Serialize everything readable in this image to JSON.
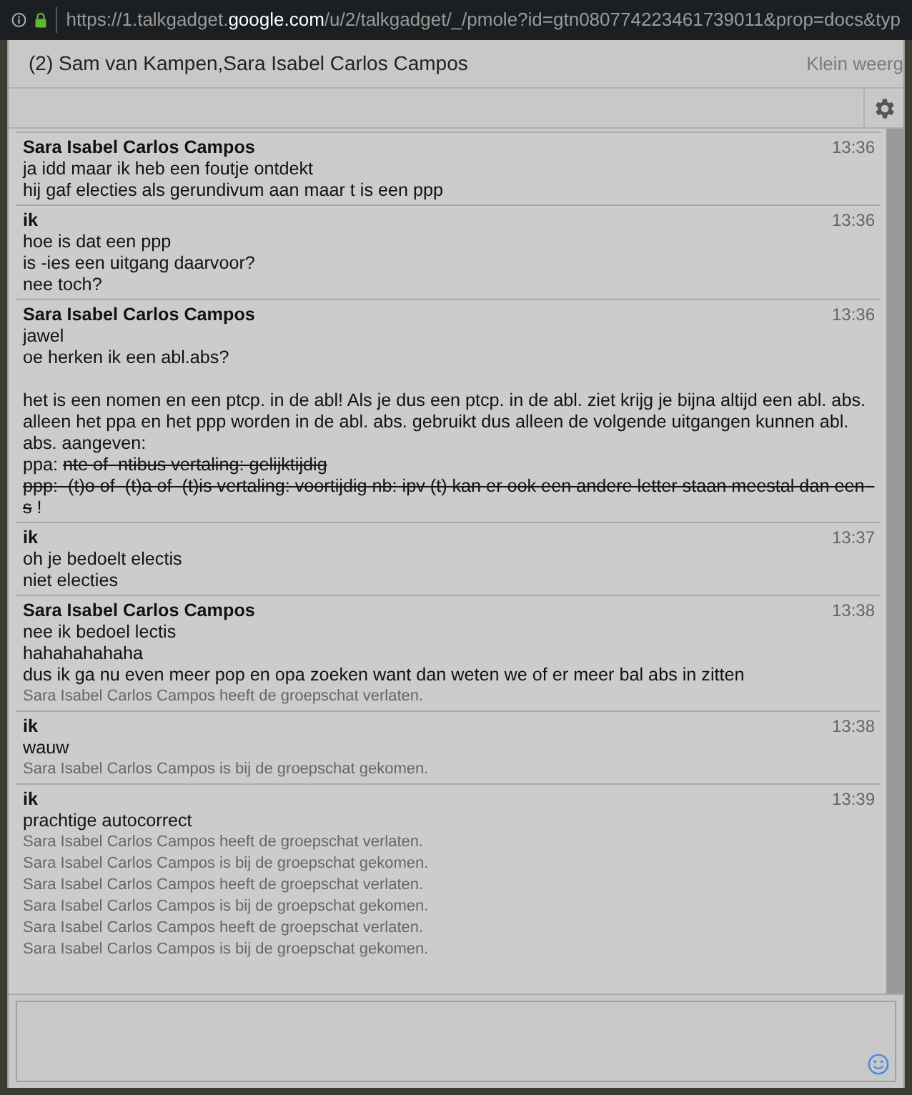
{
  "address_bar": {
    "url_parts": [
      {
        "text": "https://1.talkgadget.",
        "emphasis": false
      },
      {
        "text": "google.com",
        "emphasis": true
      },
      {
        "text": "/u/2/talkgadget/_/pmole?id=gtn080774223461739011&prop=docs&typ",
        "emphasis": false
      }
    ]
  },
  "window": {
    "title": "(2) Sam van Kampen,Sara Isabel Carlos Campos",
    "action": "Klein weerg"
  },
  "messages": [
    {
      "sender": "Sara Isabel Carlos Campos",
      "time": "13:36",
      "lines": [
        {
          "kind": "text",
          "segments": [
            {
              "text": "ja idd maar ik heb een foutje ontdekt",
              "struck": false
            }
          ]
        },
        {
          "kind": "text",
          "segments": [
            {
              "text": "hij gaf electies als gerundivum aan maar t is een ppp",
              "struck": false
            }
          ]
        }
      ]
    },
    {
      "sender": "ik",
      "time": "13:36",
      "lines": [
        {
          "kind": "text",
          "segments": [
            {
              "text": "hoe is dat een ppp",
              "struck": false
            }
          ]
        },
        {
          "kind": "text",
          "segments": [
            {
              "text": "is -ies een uitgang daarvoor?",
              "struck": false
            }
          ]
        },
        {
          "kind": "text",
          "segments": [
            {
              "text": "nee toch?",
              "struck": false
            }
          ]
        }
      ]
    },
    {
      "sender": "Sara Isabel Carlos Campos",
      "time": "13:36",
      "lines": [
        {
          "kind": "text",
          "segments": [
            {
              "text": "jawel",
              "struck": false
            }
          ]
        },
        {
          "kind": "text",
          "segments": [
            {
              "text": "oe herken ik een abl.abs?",
              "struck": false
            }
          ]
        },
        {
          "kind": "blank"
        },
        {
          "kind": "text",
          "segments": [
            {
              "text": "het is een nomen en een ptcp. in de abl! Als je dus een ptcp. in de abl. ziet krijg je bijna altijd een abl. abs.",
              "struck": false
            }
          ]
        },
        {
          "kind": "text",
          "segments": [
            {
              "text": "alleen het ppa en het ppp worden in de abl. abs. gebruikt dus alleen de volgende uitgangen kunnen abl. abs. aangeven:",
              "struck": false
            }
          ]
        },
        {
          "kind": "text",
          "segments": [
            {
              "text": "ppa: ",
              "struck": false
            },
            {
              "text": "nte of  ntibus vertaling: gelijktijdig",
              "struck": true
            }
          ]
        },
        {
          "kind": "text",
          "segments": [
            {
              "text": "ppp:  (t)o of  (t)a of  (t)is vertaling: voortijdig nb: ipv (t) kan er ook een andere letter staan meestal dan een  s",
              "struck": true
            },
            {
              "text": " !",
              "struck": false
            }
          ]
        }
      ]
    },
    {
      "sender": "ik",
      "time": "13:37",
      "lines": [
        {
          "kind": "text",
          "segments": [
            {
              "text": "oh je bedoelt electis",
              "struck": false
            }
          ]
        },
        {
          "kind": "text",
          "segments": [
            {
              "text": "niet electies",
              "struck": false
            }
          ]
        }
      ]
    },
    {
      "sender": "Sara Isabel Carlos Campos",
      "time": "13:38",
      "lines": [
        {
          "kind": "text",
          "segments": [
            {
              "text": "nee ik bedoel lectis",
              "struck": false
            }
          ]
        },
        {
          "kind": "text",
          "segments": [
            {
              "text": "hahahahahaha",
              "struck": false
            }
          ]
        },
        {
          "kind": "text",
          "segments": [
            {
              "text": "dus ik ga nu even meer pop en opa zoeken want dan weten we of er meer bal abs in zitten",
              "struck": false
            }
          ]
        },
        {
          "kind": "system",
          "text": "Sara Isabel Carlos Campos heeft de groepschat verlaten."
        }
      ]
    },
    {
      "sender": "ik",
      "time": "13:38",
      "lines": [
        {
          "kind": "text",
          "segments": [
            {
              "text": "wauw",
              "struck": false
            }
          ]
        },
        {
          "kind": "system",
          "text": "Sara Isabel Carlos Campos is bij de groepschat gekomen."
        }
      ]
    },
    {
      "sender": "ik",
      "time": "13:39",
      "lines": [
        {
          "kind": "text",
          "segments": [
            {
              "text": "prachtige autocorrect",
              "struck": false
            }
          ]
        },
        {
          "kind": "system",
          "text": "Sara Isabel Carlos Campos heeft de groepschat verlaten."
        },
        {
          "kind": "system",
          "text": "Sara Isabel Carlos Campos is bij de groepschat gekomen."
        },
        {
          "kind": "system",
          "text": "Sara Isabel Carlos Campos heeft de groepschat verlaten."
        },
        {
          "kind": "system",
          "text": "Sara Isabel Carlos Campos is bij de groepschat gekomen."
        },
        {
          "kind": "system",
          "text": "Sara Isabel Carlos Campos heeft de groepschat verlaten."
        },
        {
          "kind": "system",
          "text": "Sara Isabel Carlos Campos is bij de groepschat gekomen."
        }
      ]
    }
  ]
}
